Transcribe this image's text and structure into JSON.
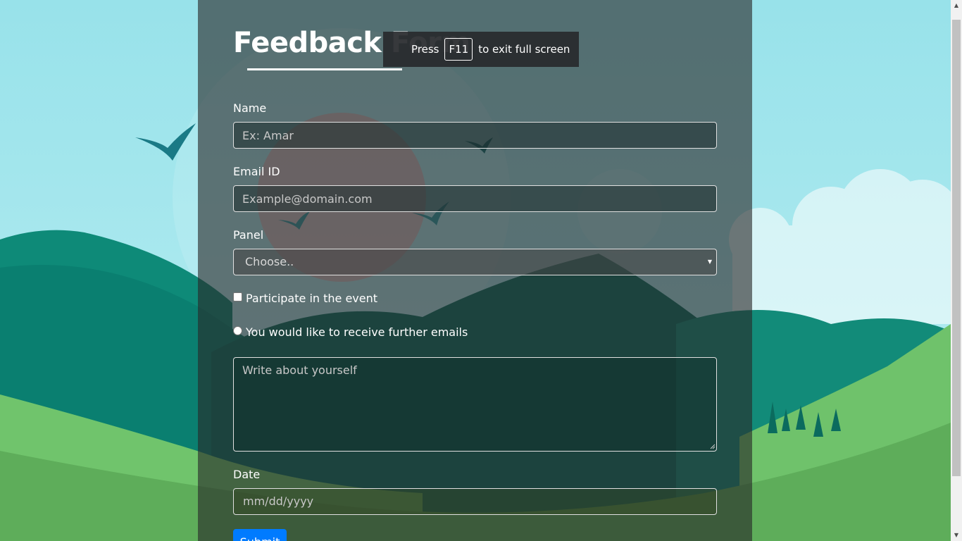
{
  "form": {
    "title": "Feedback Form",
    "name_label": "Name",
    "name_placeholder": "Ex: Amar",
    "email_label": "Email ID",
    "email_placeholder": "Example@domain.com",
    "panel_label": "Panel",
    "panel_selected": "Choose..",
    "checkbox_label": "Participate in the event",
    "checkbox_checked": false,
    "radio_label": "You would like to receive further emails",
    "radio_checked": false,
    "about_placeholder": "Write about yourself",
    "date_label": "Date",
    "date_placeholder": "mm/dd/yyyy",
    "submit_label": "Submit"
  },
  "fullscreen_notice": {
    "prefix": "Press",
    "key": "F11",
    "suffix": "to exit full screen"
  },
  "icons": {
    "select_arrow": "dropdown-arrow-icon",
    "scroll_up": "scroll-up-arrow-icon",
    "scroll_down": "scroll-down-arrow-icon"
  },
  "colors": {
    "submit_button": "#007bff",
    "sky": "#9fe3ea",
    "hill_dark": "#0f8a76",
    "hill_light": "#6cc06a"
  }
}
